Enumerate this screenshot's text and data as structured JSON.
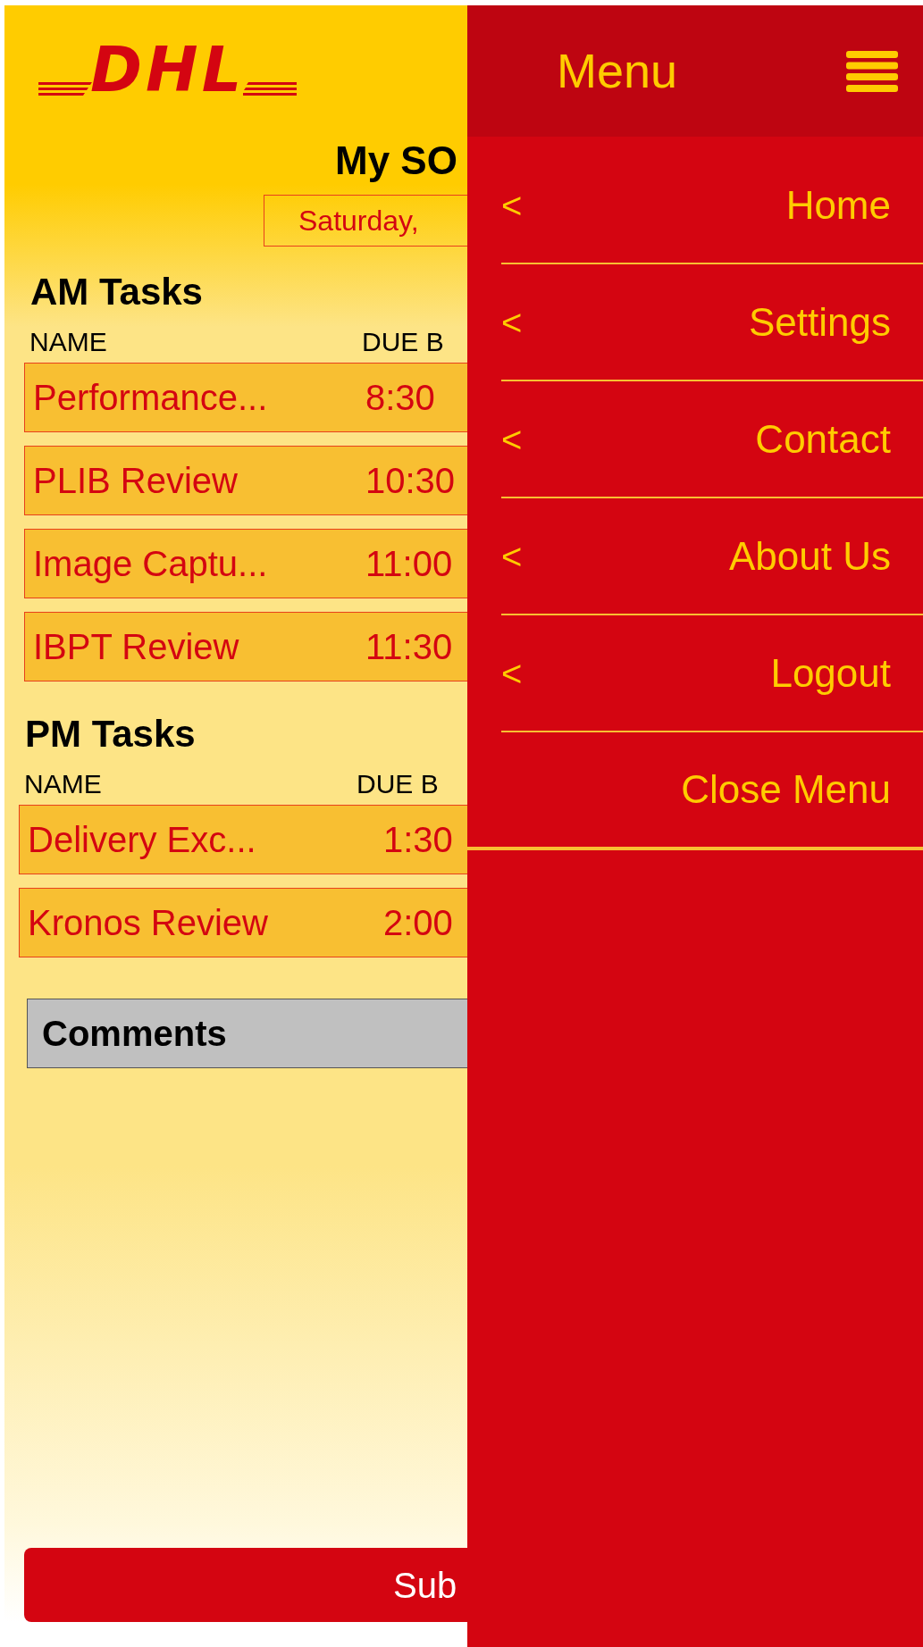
{
  "logo": {
    "text": "DHL"
  },
  "page": {
    "title": "My SO",
    "date": "Saturday,"
  },
  "am_tasks": {
    "heading": "AM Tasks",
    "columns": [
      "NAME",
      "DUE B"
    ],
    "rows": [
      {
        "name": "Performance...",
        "due": "8:30"
      },
      {
        "name": "PLIB Review",
        "due": "10:30"
      },
      {
        "name": "Image Captu...",
        "due": "11:00"
      },
      {
        "name": "IBPT Review",
        "due": "11:30"
      }
    ]
  },
  "pm_tasks": {
    "heading": "PM Tasks",
    "columns": [
      "NAME",
      "DUE B"
    ],
    "rows": [
      {
        "name": "Delivery Exc...",
        "due": "1:30"
      },
      {
        "name": "Kronos Review",
        "due": "2:00"
      }
    ]
  },
  "comments": {
    "label": "Comments"
  },
  "submit_button": "Sub",
  "menu": {
    "title": "Menu",
    "items": [
      {
        "label": "Home",
        "arrow": "<"
      },
      {
        "label": "Settings",
        "arrow": "<"
      },
      {
        "label": "Contact",
        "arrow": "<"
      },
      {
        "label": "About Us",
        "arrow": "<"
      },
      {
        "label": "Logout",
        "arrow": "<"
      },
      {
        "label": "Close Menu"
      }
    ]
  }
}
